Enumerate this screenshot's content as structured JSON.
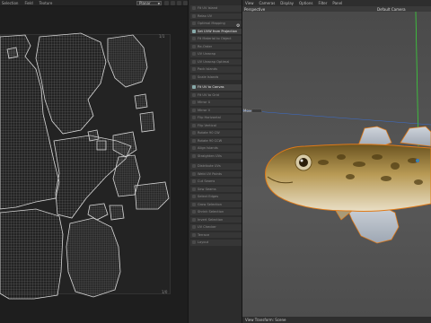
{
  "uv_editor": {
    "menu": [
      "Selection",
      "Field",
      "Texture"
    ],
    "projection": "Planar",
    "coord_top": "1/1",
    "coord_bottom": "1/0"
  },
  "commands": [
    {
      "label": "Fit UV Island",
      "active": false
    },
    {
      "label": "Relax UV",
      "active": false
    },
    {
      "label": "Optimal Mapping",
      "active": false
    },
    {
      "label": "Set UVW from Projection",
      "active": true
    },
    {
      "label": "Fit Material to Object",
      "active": false
    },
    {
      "label": "Re-Order",
      "active": false
    },
    {
      "label": "UV Unwrap",
      "active": false
    },
    {
      "label": "UV Unwrap Optimal",
      "active": false
    },
    {
      "label": "Pack Islands",
      "active": false
    },
    {
      "label": "Scale Islands",
      "active": false
    },
    {
      "label": "Fit UV to Canvas",
      "active": true
    },
    {
      "label": "Fit UV to Grid",
      "active": false
    },
    {
      "label": "Mirror U",
      "active": false
    },
    {
      "label": "Mirror V",
      "active": false
    },
    {
      "label": "Flip Horizontal",
      "active": false
    },
    {
      "label": "Flip Vertical",
      "active": false
    },
    {
      "label": "Rotate 90 CW",
      "active": false
    },
    {
      "label": "Rotate 90 CCW",
      "active": false
    },
    {
      "label": "Align Islands",
      "active": false
    },
    {
      "label": "Straighten UVs",
      "active": false
    },
    {
      "label": "Distribute UVs",
      "active": false
    },
    {
      "label": "Weld UV Points",
      "active": false
    },
    {
      "label": "Cut Seams",
      "active": false
    },
    {
      "label": "Sew Seams",
      "active": false
    },
    {
      "label": "Select Edges",
      "active": false
    },
    {
      "label": "Grow Selection",
      "active": false
    },
    {
      "label": "Shrink Selection",
      "active": false
    },
    {
      "label": "Invert Selection",
      "active": false
    },
    {
      "label": "UV Checker",
      "active": false
    },
    {
      "label": "Terrace",
      "active": false
    },
    {
      "label": "Layout",
      "active": false
    }
  ],
  "viewport": {
    "menu": [
      "View",
      "Cameras",
      "Display",
      "Options",
      "Filter",
      "Panel"
    ],
    "perspective": "Perspective",
    "camera": "Default Camera",
    "move_label": "Move",
    "footer": "View Transform: Scene"
  },
  "colors": {
    "accent_orange": "#e07a18",
    "axis_green": "#3ad23a",
    "axis_blue": "#3a6ed2"
  }
}
